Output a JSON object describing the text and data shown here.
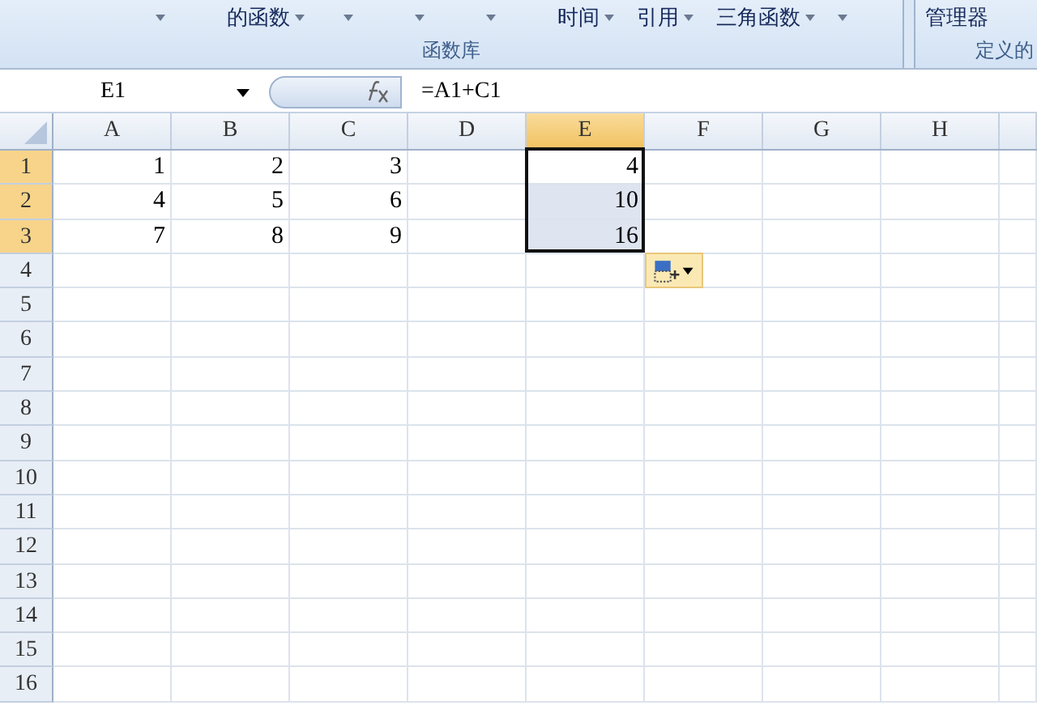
{
  "ribbon": {
    "items": [
      {
        "kind": "arrow"
      },
      {
        "kind": "labeled",
        "label": "的函数"
      },
      {
        "kind": "arrow"
      },
      {
        "kind": "arrow"
      },
      {
        "kind": "arrow"
      },
      {
        "kind": "labeled",
        "label": "时间"
      },
      {
        "kind": "labeled",
        "label": "引用"
      },
      {
        "kind": "labeled",
        "label": "三角函数"
      },
      {
        "kind": "arrow"
      }
    ],
    "group_label": "函数库",
    "next_group": {
      "item": "管理器",
      "label": "定义的"
    }
  },
  "formula_bar": {
    "name_box": "E1",
    "formula": "=A1+C1"
  },
  "columns": [
    {
      "label": "A",
      "selected": false
    },
    {
      "label": "B",
      "selected": false
    },
    {
      "label": "C",
      "selected": false
    },
    {
      "label": "D",
      "selected": false
    },
    {
      "label": "E",
      "selected": true
    },
    {
      "label": "F",
      "selected": false
    },
    {
      "label": "G",
      "selected": false
    },
    {
      "label": "H",
      "selected": false
    }
  ],
  "rows": [
    {
      "label": "1",
      "selected": true,
      "active": true,
      "cells": [
        "1",
        "2",
        "3",
        null,
        "4",
        null,
        null,
        null
      ]
    },
    {
      "label": "2",
      "selected": true,
      "active": false,
      "cells": [
        "4",
        "5",
        "6",
        null,
        "10",
        null,
        null,
        null
      ]
    },
    {
      "label": "3",
      "selected": true,
      "active": false,
      "cells": [
        "7",
        "8",
        "9",
        null,
        "16",
        null,
        null,
        null
      ]
    },
    {
      "label": "4",
      "selected": false,
      "active": false,
      "cells": []
    },
    {
      "label": "5",
      "selected": false,
      "active": false,
      "cells": []
    },
    {
      "label": "6",
      "selected": false,
      "active": false,
      "cells": []
    },
    {
      "label": "7",
      "selected": false,
      "active": false,
      "cells": []
    },
    {
      "label": "8",
      "selected": false,
      "active": false,
      "cells": []
    },
    {
      "label": "9",
      "selected": false,
      "active": false,
      "cells": []
    },
    {
      "label": "10",
      "selected": false,
      "active": false,
      "cells": []
    },
    {
      "label": "11",
      "selected": false,
      "active": false,
      "cells": []
    },
    {
      "label": "12",
      "selected": false,
      "active": false,
      "cells": []
    },
    {
      "label": "13",
      "selected": false,
      "active": false,
      "cells": []
    },
    {
      "label": "14",
      "selected": false,
      "active": false,
      "cells": []
    },
    {
      "label": "15",
      "selected": false,
      "active": false,
      "cells": []
    },
    {
      "label": "16",
      "selected": false,
      "active": false,
      "cells": []
    }
  ]
}
